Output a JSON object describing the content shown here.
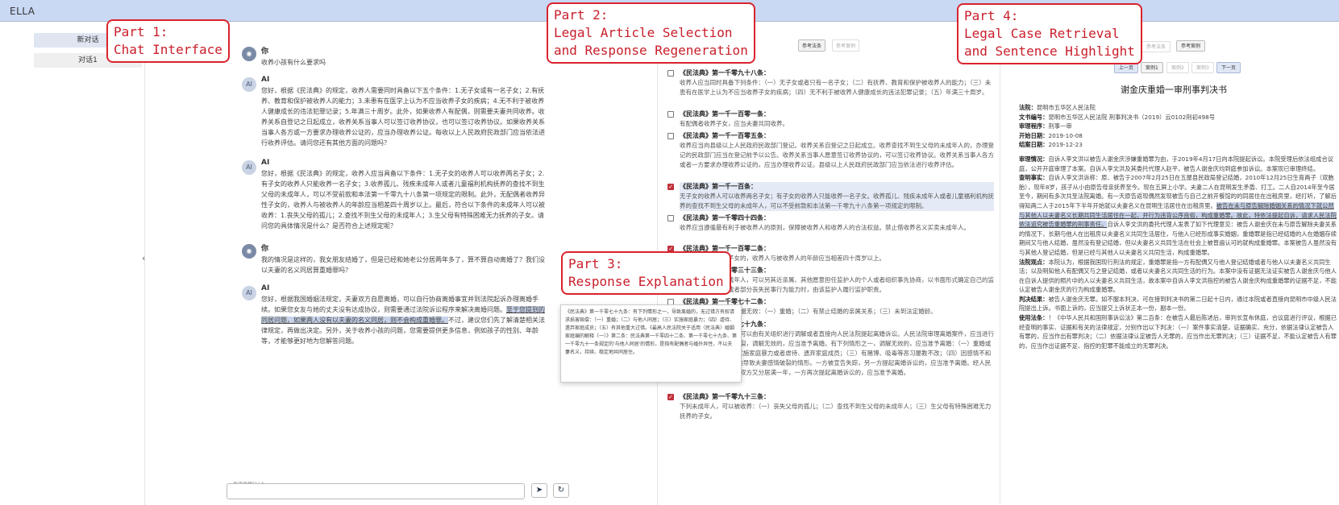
{
  "app": {
    "title": "ELLA"
  },
  "sidebar": {
    "items": [
      {
        "label": "新对话"
      },
      {
        "label": "对话1"
      }
    ],
    "collapse_icon": "‹"
  },
  "chat": {
    "messages": [
      {
        "sender": "你",
        "text": "收养小孩有什么要求吗"
      },
      {
        "sender": "AI",
        "text": "您好，根据《民法典》的规定，收养人需要同时具备以下五个条件：1.无子女或有一名子女；2.有抚养、教育和保护被收养人的能力；3.未患有在医学上认为不应当收养子女的疾病；4.无不利于被收养人健康成长的违法犯罪记录；5.年满三十周岁。此外，如果收养人有配偶，则需要夫妻共同收养。收养关系自登记之日起成立，收养关系当事人可以签订收养协议，也可以签订收养协议。如果收养关系当事人各方或一方要求办理收养公证的，应当办理收养公证。每收以上人民政府民政部门应当依法进行收养评估。请问您还有其他方面的问题吗？"
      },
      {
        "sender": "AI",
        "text": "您好，根据《民法典》的规定，收养人应当具备以下条件：1.无子女的收养人可以收养两名子女；2.有子女的收养人只能收养一名子女；3.收养孤儿、残疾未成年人或者儿童福利机构抚养的查找不到生父母的未成年人，可以不受前款和本法第一千零九十八条第一项规定的限制。此外，无配偶者收养异性子女的，收养人与被收养人的年龄应当相差四十周岁以上。最后，符合以下条件的未成年人可以被收养：1.丧失父母的孤儿；2.查找不到生父母的未成年人；3.生父母有特殊困难无力抚养的子女。请问您的具体情况是什么？是否符合上述规定呢？"
      },
      {
        "sender": "你",
        "text": "我的情况是这样的，我女朋友结婚了，但是已经和她老公分居两年多了，算不算自动离婚了？我们没以夫妻的名义同居算重婚罪吗？"
      },
      {
        "sender": "AI",
        "text_a": "您好，根据我国婚姻法规定，夫妻双方自愿离婚，可以自行协商离婚事宜并到法院起诉办理离婚手续。如果您女友与她的丈夫没有达成协议，则需要通过法院诉讼程序来解决离婚问题。",
        "text_hl": "至于您提到的同居问题，如果两人没有以夫妻的名义同居，则不会构成重婚罪。",
        "text_b": "不过，建议您们先了解清楚相关法律规定，再做出决定。另外，关于收养小孩的问题，您需要提供更多信息，例如孩子的性别、年龄等，才能够更好地为您解答问题。"
      }
    ],
    "input_placeholder": "发消息给ELLA...",
    "send_icon": "➤",
    "regen_icon": "↻"
  },
  "articles": {
    "tabs": [
      {
        "label": "参考法条"
      },
      {
        "label": "参考案例"
      }
    ],
    "items": [
      {
        "title": "《民法典》第一千零九十八条：",
        "text": "收养人应当同时具备下列条件：（一）无子女或者只有一名子女；（二）有抚养、教育和保护被收养人的能力；（三）未患有在医学上认为不应当收养子女的疾病；（四）无不利于被收养人健康成长的违法犯罪记录；（五）年满三十周岁。",
        "checked": false
      },
      {
        "title": "《民法典》第一千一百零一条：",
        "text": "有配偶者收养子女，应当夫妻共同收养。",
        "checked": false
      },
      {
        "title": "《民法典》第一千一百零五条：",
        "text": "收养应当向县级以上人民政府民政部门登记。收养关系自登记之日起成立。收养查找不到生父母的未成年人的，办理登记的民政部门应当在登记前予以公告。收养关系当事人愿意签订收养协议的，可以签订收养协议。收养关系当事人各方或者一方要求办理收养公证的，应当办理收养公证。县级以上人民政府民政部门应当依法进行收养评估。",
        "checked": false
      },
      {
        "title": "《民法典》第一千一百条：",
        "text": "无子女的收养人可以收养两名子女；有子女的收养人只能收养一名子女。收养孤儿、残疾未成年人或者儿童福利机构抚养的查找不到生父母的未成年人，可以不受前款和本法第一千零九十八条第一项规定的限制。",
        "checked": true
      },
      {
        "title": "《民法典》第一千零四十四条：",
        "text": "收养应当遵循最有利于被收养人的原则，保障被收养人和收养人的合法权益。禁止借收养名义买卖未成年人。",
        "checked": false
      },
      {
        "title": "《民法典》第一千一百零二条：",
        "text": "无配偶者收养异性子女的，收养人与被收养人的年龄应当相差四十周岁以上。",
        "checked": true
      },
      {
        "title": "《民法典》第一千零三十三条：",
        "text": "无民事行为能力的成年人，可以另其近亲属、其他愿意担任监护人的个人或者组织事先协商，以书面形式确定自己的监护人，在自己丧失或者部分丧失民事行为能力时，由该监护人履行监护职责。",
        "checked": false
      },
      {
        "title": "《民法典》第一千零七十二条：",
        "text": "夫妻一方擅自处分。婚姻无效：（一）重婚；（二）有禁止结婚的亲属关系；（三）未到法定婚龄。",
        "checked": false
      },
      {
        "title": "《民法典》第一千零七十九条：",
        "text": "夫妻一方要求离婚的，可以由有关组织进行调解或者直接向人民法院提起离婚诉讼。人民法院审理离婚案件，应当进行调解；如果感情确已破裂，调解无效的，应当准予离婚。有下列情形之一，调解无效的，应当准予离婚：（一）重婚或者与他人同居；（二）实施家庭暴力或者虐待、遗弃家庭成员；（三）有赌博、吸毒等恶习屡教不改；（四）因感情不和分居满二年；（五）其他导致夫妻感情破裂的情形。一方被宣告失踪，另一方提起离婚诉讼的，应当准予离婚。经人民法院判决不准离婚后，双方又分居满一年，一方再次提起离婚诉讼的，应当准予离婚。",
        "checked": false
      },
      {
        "title": "《民法典》第一千零九十三条：",
        "text": "下列未成年人，可以被收养：（一）丧失父母的孤儿；（二）查找不到生父母的未成年人；（三）生父母有特殊困难无力抚养的子女。",
        "checked": true
      }
    ],
    "popup_text": "《民法典》第一千零七十九条：有下列情形之一，导致离婚的，无过错方有权请求损害赔偿：（一）重婚；（二）与他人同居；（三）实施家庭暴力；（四）虐待、遗弃家庭成员；（五）有其他重大过错。《最高人民法院关于适用〈民法典〉婚姻家庭编的解释（一）》第二条：民法典第一千零四十二条、第一千零七十九条、第一千零九十一条规定的'与他人同居'的情形，是指有配偶者与婚外异性，不以夫妻名义，持续、稳定地共同居住。",
    "popup_arrow": "›"
  },
  "cases": {
    "tabs": [
      {
        "label": "参考法条"
      },
      {
        "label": "参考案例"
      }
    ],
    "nav": [
      {
        "label": "上一页"
      },
      {
        "label": "案例1"
      },
      {
        "label": "案例2"
      },
      {
        "label": "案例3"
      },
      {
        "label": "下一页"
      }
    ],
    "title": "谢金庆重婚一审刑事判决书",
    "fields": [
      {
        "k": "法院：",
        "v": "昆明市五华区人民法院"
      },
      {
        "k": "文书编号：",
        "v": "昆明市五华区人民法院 刑事判决书（2019）云0102刑初498号"
      },
      {
        "k": "审理程序：",
        "v": "刑事一审"
      },
      {
        "k": "开始日期：",
        "v": "2019-10-08"
      },
      {
        "k": "结案日期：",
        "v": "2019-12-23"
      }
    ],
    "sections": [
      {
        "k": "审理情况：",
        "v": "自诉人李文洪以被告人谢金庆涉嫌重婚罪为由，于2019年4月17日向本院提起诉讼。本院受理后依法组成合议庭，公开开庭审理了本案。自诉人李文洪及其委托代理人赵平，被告人谢金庆均到庭参加诉讼。本案现已审理终结。"
      },
      {
        "k": "查明事实：",
        "v": "自诉人李文洪诉称：原、被告于2007年2月25日在五屋县民政局登记结婚，2010年12月25日生育两子（双胞胎），现年8岁，孩子从小由原告母亲抚养至今。现在五屏上小学。夫妻二人在昆明发生矛盾、打工。二人自2014年至今居至今，期间有多次共至法院离婚。有一天原告返现偶然发现被告与自己之前开餐馆的的同居住在出租房里，经打听，了解后得知两二人于2015年下半年开始就以夫妻名义在昆明生活居住在出租房里。"
      },
      {
        "k": "",
        "v": "被告在未与原告解除婚姻关系的情况下就公然与其他人以夫妻名义长期共同生活居住在一起，并行为违背公序良俗，构成重婚罪。故此，特依法提起自诉，请求人民法院依法追究被告重婚罪的刑事责任。"
      },
      {
        "k": "",
        "v": "自诉人李文洪的委托代理人发表了如下代理意见：被告人谢金庆在未与原告解除夫妻关系的情况下，长期与他人在出租房以夫妻名义共同生活居住，与他人已经形成事实婚姻，重婚罪是指已经结婚的人在婚姻存续期间又与他人结婚，虽然没有登记结婚，但以夫妻名义共同生活在社会上被普遍认可的就构成重婚罪。本案被告人虽然没有与其他人登记结婚，但是已经与其他人以夫妻名义共同生活，构成重婚罪。"
      },
      {
        "k": "法院观点：",
        "v": "本院认为，根据我国现行刑法的规定，重婚罪是指一方有配偶又与他人登记结婚或者与他人以夫妻名义共同生活；以及明知他人有配偶又与之登记结婚，或者以夫妻名义共同生活的行为。本案中没有证据无法证实被告人谢金庆与他人在自诉人提供的照片中的人以夫妻名义共同生活，故本案中自诉人李文洪指控的被告人谢金庆构成重婚罪的证据不足，不能认定被告人谢金庆的行为构成重婚罪。"
      },
      {
        "k": "判决结果：",
        "v": "被告人谢金庆无罪。如不服本判决，可在接到判决书的第二日起十日内，通过本院或者直接向昆明市中级人民法院提出上诉。书面上诉的，应当提交上诉状正本一份，副本一份。"
      },
      {
        "k": "使用法条：",
        "v": "！《中华人民共和国刑事诉讼法》第二百条：在被告人最后陈述后，审判长宣布休庭，合议庭进行评议，根据已经查明的事实、证据和有关的法律规定，分别作出以下判决：（一）案件事实清楚，证据确实、充分，依据法律认定被告人有罪的，应当作出有罪判决；（二）依据法律认定被告人无罪的，应当作出无罪判决；（三）证据不足，不能认定被告人有罪的，应当作出证据不足、指控的犯罪不能成立的无罪判决。"
      }
    ]
  },
  "callouts": {
    "part1": "Part 1:\nChat Interface",
    "part2": "Part 2:\nLegal Article Selection\nand Response Regeneration",
    "part3": "Part 3:\nResponse Explanation",
    "part4": "Part 4:\nLegal Case Retrieval\nand Sentence Highlight"
  }
}
